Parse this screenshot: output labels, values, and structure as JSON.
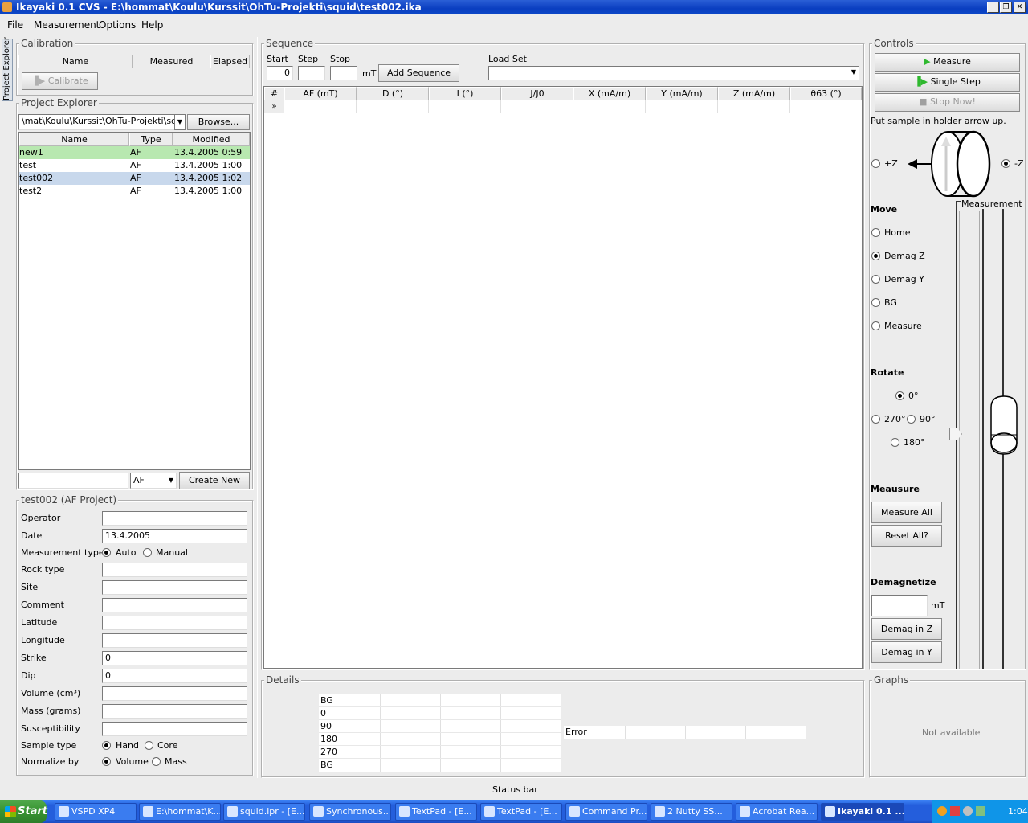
{
  "window": {
    "title": "Ikayaki 0.1 CVS - E:\\hommat\\Koulu\\Kurssit\\OhTu-Projekti\\squid\\test002.ika"
  },
  "menu": [
    "File",
    "Measurement",
    "Options",
    "Help"
  ],
  "sidetab": {
    "label": "Project Explorer"
  },
  "calibration": {
    "title": "Calibration",
    "columns": [
      "Name",
      "Measured",
      "Elapsed"
    ],
    "calibrate_label": "Calibrate"
  },
  "explorer": {
    "title": "Project Explorer",
    "path": "\\mat\\Koulu\\Kurssit\\OhTu-Projekti\\squid",
    "browse_label": "Browse...",
    "columns": [
      "Name",
      "Type",
      "Modified"
    ],
    "rows": [
      {
        "name": "new1",
        "type": "AF",
        "modified": "13.4.2005 0:59"
      },
      {
        "name": "test",
        "type": "AF",
        "modified": "13.4.2005 1:00"
      },
      {
        "name": "test002",
        "type": "AF",
        "modified": "13.4.2005 1:02"
      },
      {
        "name": "test2",
        "type": "AF",
        "modified": "13.4.2005 1:00"
      }
    ],
    "new_type": "AF",
    "create_label": "Create New"
  },
  "project": {
    "title": "test002 (AF Project)",
    "fields": [
      {
        "label": "Operator",
        "value": ""
      },
      {
        "label": "Date",
        "value": "13.4.2005"
      },
      {
        "label": "Rock type",
        "value": ""
      },
      {
        "label": "Site",
        "value": ""
      },
      {
        "label": "Comment",
        "value": ""
      },
      {
        "label": "Latitude",
        "value": ""
      },
      {
        "label": "Longitude",
        "value": ""
      },
      {
        "label": "Strike",
        "value": "0"
      },
      {
        "label": "Dip",
        "value": "0"
      },
      {
        "label": "Volume (cm³)",
        "value": ""
      },
      {
        "label": "Mass (grams)",
        "value": ""
      },
      {
        "label": "Susceptibility",
        "value": ""
      }
    ],
    "measurement_type": {
      "label": "Measurement type",
      "options": [
        "Auto",
        "Manual"
      ],
      "selected": "Auto"
    },
    "sample_type": {
      "label": "Sample type",
      "options": [
        "Hand",
        "Core"
      ],
      "selected": "Hand"
    },
    "normalize_by": {
      "label": "Normalize by",
      "options": [
        "Volume",
        "Mass"
      ],
      "selected": "Volume"
    }
  },
  "sequence": {
    "title": "Sequence",
    "start_label": "Start",
    "start_value": "0",
    "step_label": "Step",
    "step_value": "",
    "stop_label": "Stop",
    "stop_value": "",
    "unit": "mT",
    "add_label": "Add Sequence",
    "loadset_label": "Load Set",
    "loadset_value": "",
    "columns": [
      "#",
      "AF (mT)",
      "D (°)",
      "I (°)",
      "J/J0",
      "X (mA/m)",
      "Y (mA/m)",
      "Z (mA/m)",
      "θ63 (°)"
    ],
    "new_row_marker": "»"
  },
  "details": {
    "title": "Details",
    "rows": [
      "BG",
      "0",
      "90",
      "180",
      "270",
      "BG"
    ],
    "error_label": "Error"
  },
  "status": {
    "text": "Status bar"
  },
  "controls": {
    "title": "Controls",
    "measure_label": "Measure",
    "single_step_label": "Single Step",
    "stop_label": "Stop Now!",
    "instruction": "Put sample in holder arrow up.",
    "plus_z": "+Z",
    "minus_z": "-Z",
    "selected_orientation": "-Z",
    "measurement_label": "Measurement",
    "move_title": "Move",
    "move_options": [
      "Home",
      "Demag Z",
      "Demag Y",
      "BG",
      "Measure"
    ],
    "move_selected": "Demag Z",
    "rotate_title": "Rotate",
    "rotate_options": [
      "0°",
      "270°",
      "90°",
      "180°"
    ],
    "rotate_selected": "0°",
    "measure_title": "Meausure",
    "measure_all_label": "Measure All",
    "reset_all_label": "Reset All?",
    "demag_title": "Demagnetize",
    "demag_value": "",
    "demag_unit": "mT",
    "demag_z_label": "Demag in Z",
    "demag_y_label": "Demag in Y"
  },
  "graphs": {
    "title": "Graphs",
    "placeholder": "Not available"
  },
  "taskbar": {
    "start_label": "Start",
    "items": [
      "VSPD XP4",
      "E:\\hommat\\K...",
      "squid.ipr - [E...",
      "Synchronous...",
      "TextPad - [E...",
      "TextPad - [E...",
      "Command Pr...",
      "2 Nutty SS...",
      "Acrobat Rea...",
      "Ikayaki 0.1 ..."
    ],
    "active": "Ikayaki 0.1 ...",
    "clock": "1:04"
  }
}
